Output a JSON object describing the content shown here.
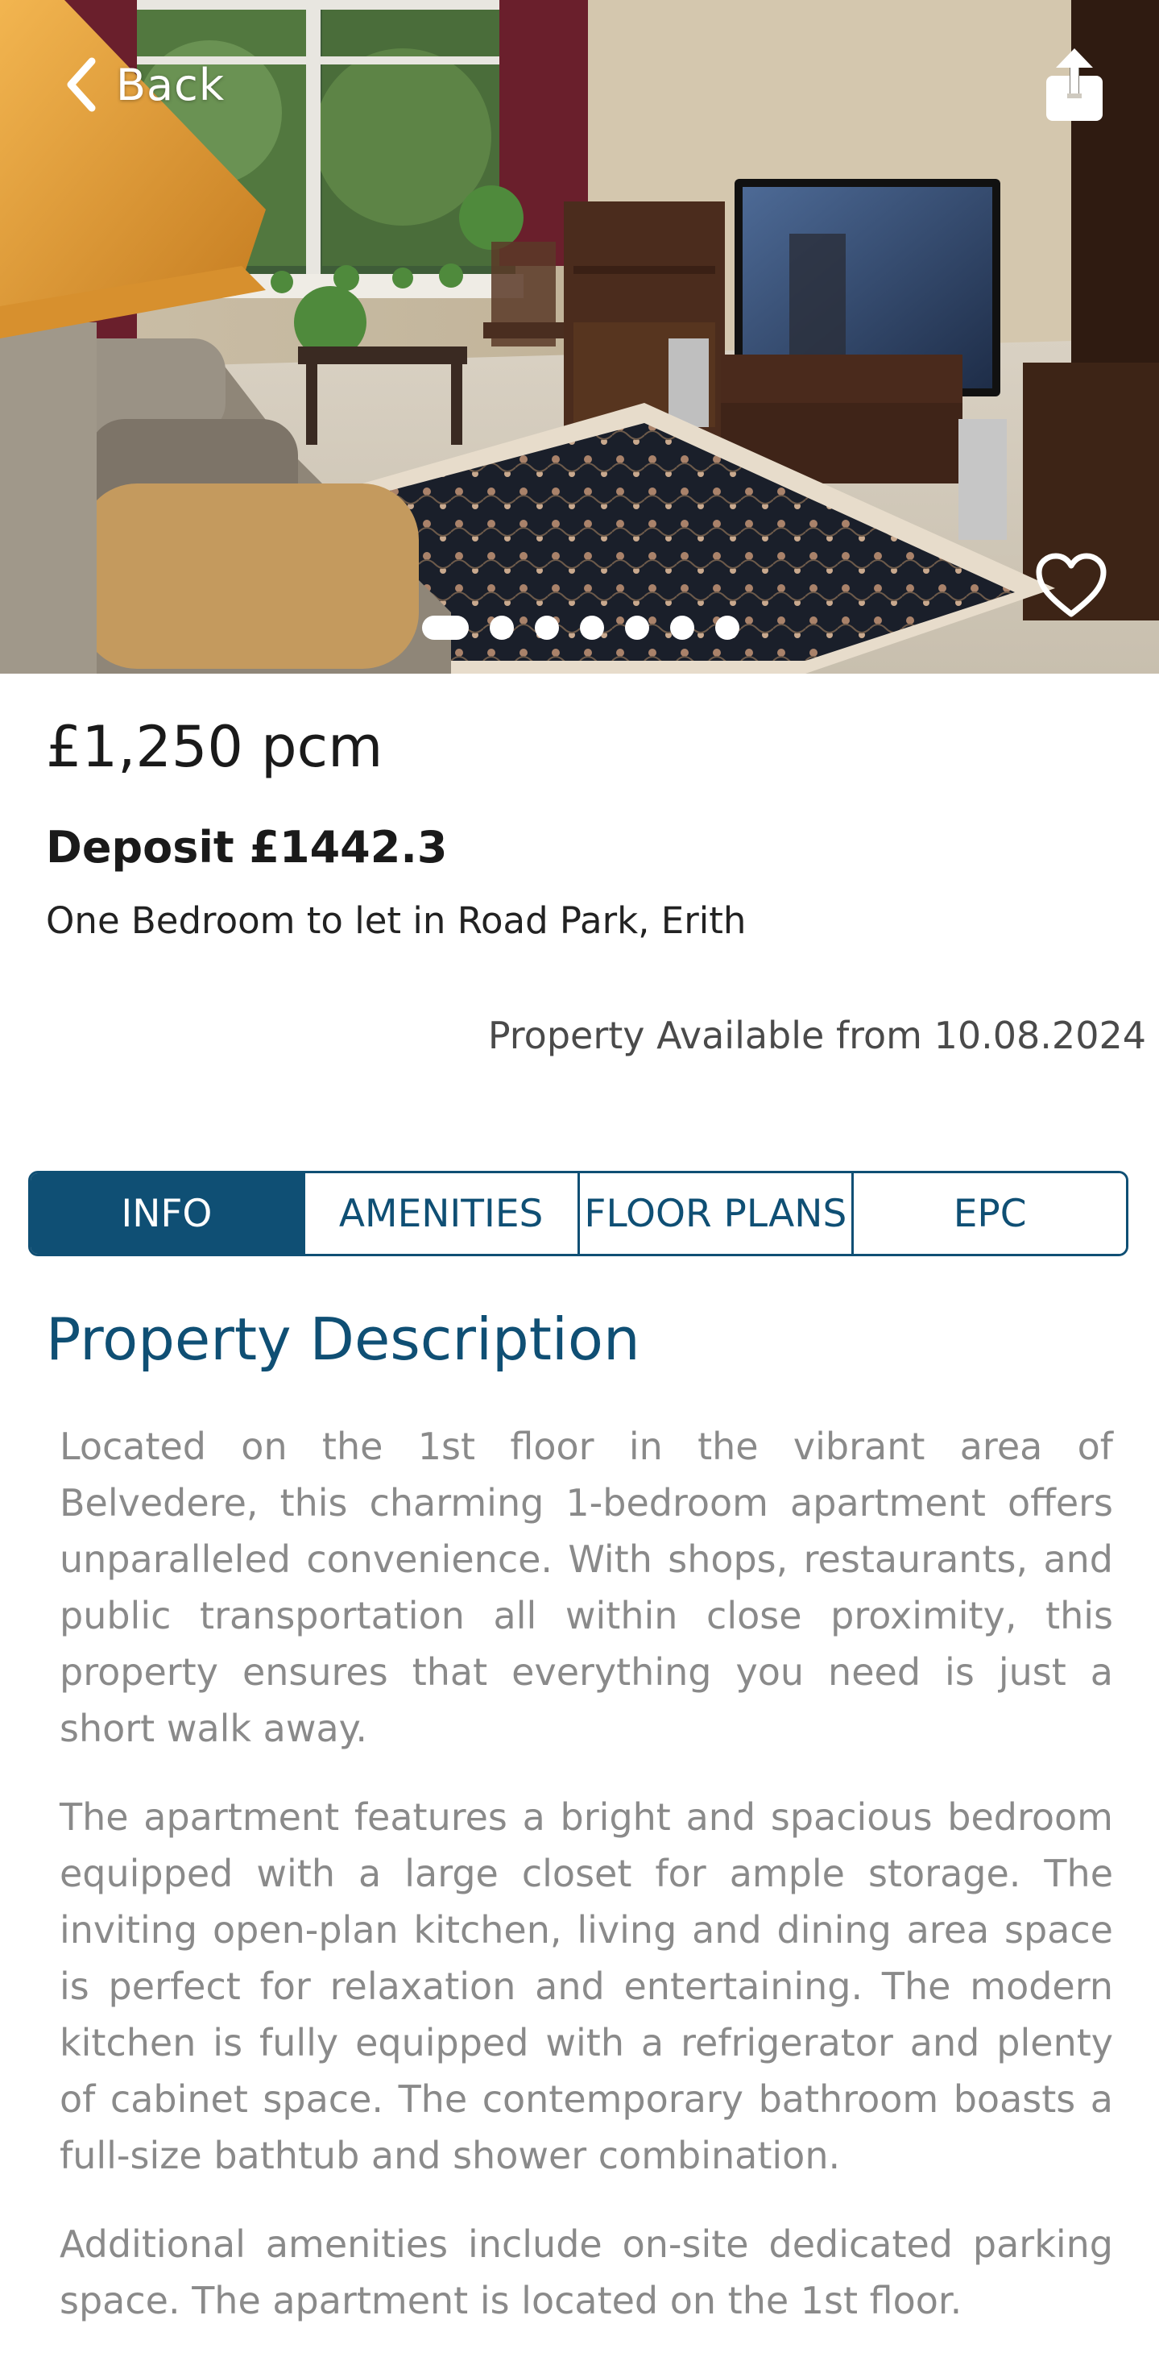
{
  "nav": {
    "back_label": "Back"
  },
  "gallery": {
    "photo_count": 7,
    "active_index": 0
  },
  "listing": {
    "price": "£1,250 pcm",
    "deposit": "Deposit £1442.3",
    "title": "One Bedroom to let in Road Park, Erith",
    "availability": "Property Available from 10.08.2024"
  },
  "tabs": [
    {
      "label": "INFO",
      "active": true
    },
    {
      "label": "AMENITIES",
      "active": false
    },
    {
      "label": "FLOOR PLANS",
      "active": false
    },
    {
      "label": "EPC",
      "active": false
    }
  ],
  "description": {
    "heading": "Property Description",
    "paragraphs": [
      "Located on the 1st floor in the vibrant area of Belvedere, this charming 1-bedroom apartment offers unparalleled convenience. With shops, restaurants, and public transportation all within close proximity, this property ensures that everything you need is just a short walk away.",
      "The apartment features a bright and spacious bedroom equipped with a large closet for ample storage. The inviting open-plan kitchen, living and dining area space is perfect for relaxation and entertaining. The modern kitchen is fully equipped with a refrigerator and plenty of cabinet space. The contemporary bathroom boasts a full-size bathtub and shower combination.",
      "Additional amenities include on-site dedicated parking space. The apartment is located on the 1st floor."
    ]
  },
  "colors": {
    "brand": "#0f4f74",
    "body_text": "#8a8a8a",
    "heading_text": "#1a1a1a"
  },
  "icons": {
    "back": "chevron-left-icon",
    "share": "share-icon",
    "favorite": "heart-outline-icon"
  }
}
